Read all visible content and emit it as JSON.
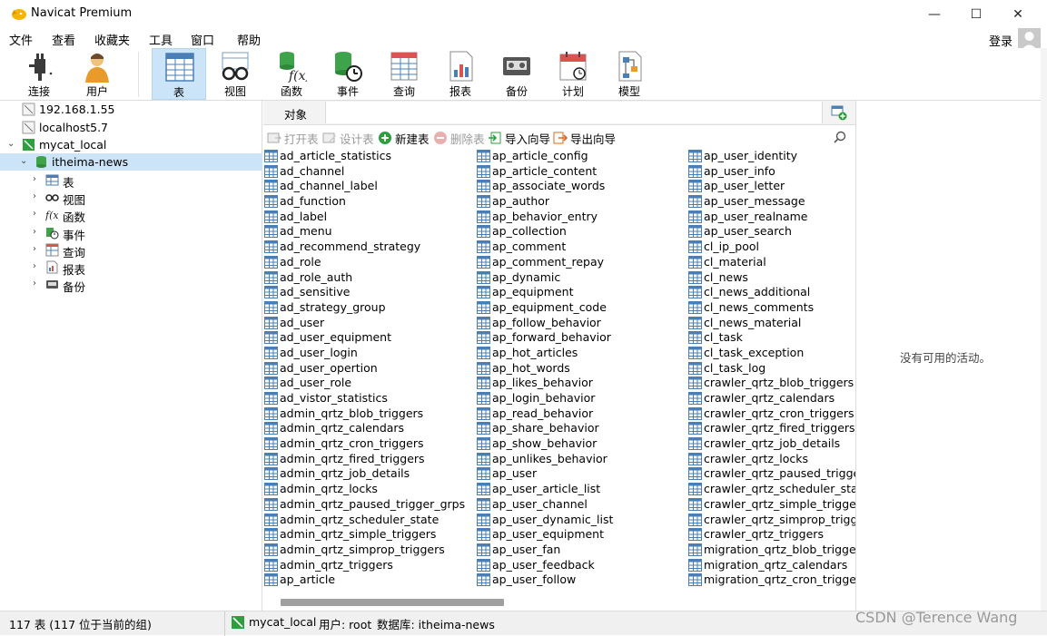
{
  "window": {
    "title": "Navicat Premium",
    "controls": {
      "minimize": "—",
      "maximize": "☐",
      "close": "✕"
    }
  },
  "menubar": {
    "items": [
      "文件",
      "查看",
      "收藏夹",
      "工具",
      "窗口",
      "帮助"
    ],
    "login": "登录"
  },
  "toolbar": {
    "buttons": [
      {
        "label": "连接",
        "icon": "plug-icon"
      },
      {
        "label": "用户",
        "icon": "user-icon"
      },
      {
        "label": "表",
        "icon": "table-icon",
        "active": true
      },
      {
        "label": "视图",
        "icon": "glasses-icon"
      },
      {
        "label": "函数",
        "icon": "function-icon"
      },
      {
        "label": "事件",
        "icon": "event-clock-icon"
      },
      {
        "label": "查询",
        "icon": "query-grid-icon"
      },
      {
        "label": "报表",
        "icon": "report-icon"
      },
      {
        "label": "备份",
        "icon": "backup-tape-icon"
      },
      {
        "label": "计划",
        "icon": "calendar-icon"
      },
      {
        "label": "模型",
        "icon": "model-icon"
      }
    ]
  },
  "tree": {
    "connections": [
      {
        "label": "192.168.1.55"
      },
      {
        "label": "localhost5.7"
      },
      {
        "label": "mycat_local"
      }
    ],
    "database": "itheima-news",
    "nodes": [
      "表",
      "视图",
      "函数",
      "事件",
      "查询",
      "报表",
      "备份"
    ]
  },
  "object_panel": {
    "tab": "对象",
    "actions": {
      "open_table": "打开表",
      "design_table": "设计表",
      "new_table": "新建表",
      "delete_table": "删除表",
      "import_wizard": "导入向导",
      "export_wizard": "导出向导"
    },
    "columns": [
      [
        "ad_article_statistics",
        "ad_channel",
        "ad_channel_label",
        "ad_function",
        "ad_label",
        "ad_menu",
        "ad_recommend_strategy",
        "ad_role",
        "ad_role_auth",
        "ad_sensitive",
        "ad_strategy_group",
        "ad_user",
        "ad_user_equipment",
        "ad_user_login",
        "ad_user_opertion",
        "ad_user_role",
        "ad_vistor_statistics",
        "admin_qrtz_blob_triggers",
        "admin_qrtz_calendars",
        "admin_qrtz_cron_triggers",
        "admin_qrtz_fired_triggers",
        "admin_qrtz_job_details",
        "admin_qrtz_locks",
        "admin_qrtz_paused_trigger_grps",
        "admin_qrtz_scheduler_state",
        "admin_qrtz_simple_triggers",
        "admin_qrtz_simprop_triggers",
        "admin_qrtz_triggers",
        "ap_article"
      ],
      [
        "ap_article_config",
        "ap_article_content",
        "ap_associate_words",
        "ap_author",
        "ap_behavior_entry",
        "ap_collection",
        "ap_comment",
        "ap_comment_repay",
        "ap_dynamic",
        "ap_equipment",
        "ap_equipment_code",
        "ap_follow_behavior",
        "ap_forward_behavior",
        "ap_hot_articles",
        "ap_hot_words",
        "ap_likes_behavior",
        "ap_login_behavior",
        "ap_read_behavior",
        "ap_share_behavior",
        "ap_show_behavior",
        "ap_unlikes_behavior",
        "ap_user",
        "ap_user_article_list",
        "ap_user_channel",
        "ap_user_dynamic_list",
        "ap_user_equipment",
        "ap_user_fan",
        "ap_user_feedback",
        "ap_user_follow"
      ],
      [
        "ap_user_identity",
        "ap_user_info",
        "ap_user_letter",
        "ap_user_message",
        "ap_user_realname",
        "ap_user_search",
        "cl_ip_pool",
        "cl_material",
        "cl_news",
        "cl_news_additional",
        "cl_news_comments",
        "cl_news_material",
        "cl_task",
        "cl_task_exception",
        "cl_task_log",
        "crawler_qrtz_blob_triggers",
        "crawler_qrtz_calendars",
        "crawler_qrtz_cron_triggers",
        "crawler_qrtz_fired_triggers",
        "crawler_qrtz_job_details",
        "crawler_qrtz_locks",
        "crawler_qrtz_paused_trigger_",
        "crawler_qrtz_scheduler_state",
        "crawler_qrtz_simple_triggers",
        "crawler_qrtz_simprop_trigge",
        "crawler_qrtz_triggers",
        "migration_qrtz_blob_trigger:",
        "migration_qrtz_calendars",
        "migration_qrtz_cron_triggers"
      ]
    ]
  },
  "info_pane": {
    "empty_text": "没有可用的活动。"
  },
  "statusbar": {
    "count": "117 表 (117 位于当前的组)",
    "connection": "mycat_local",
    "user": "用户: root",
    "database": "数据库: itheima-news"
  },
  "watermark": "CSDN @Terence Wang",
  "colors": {
    "selection": "#cce4f7",
    "db_green": "#2e9e3e"
  }
}
